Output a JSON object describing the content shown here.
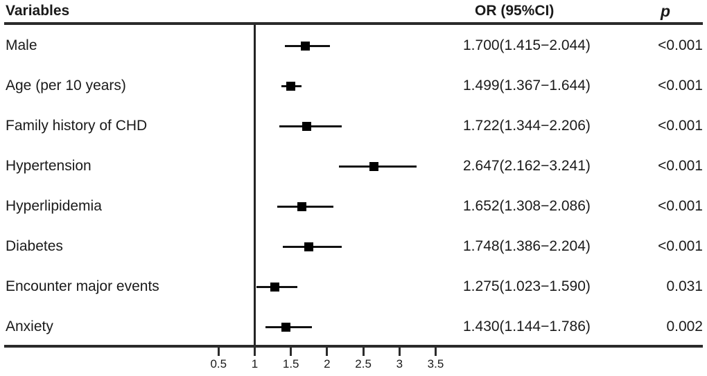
{
  "header": {
    "variables_label": "Variables",
    "or_label": "OR (95%CI)",
    "p_label": "p"
  },
  "chart_data": {
    "type": "forest",
    "title": "",
    "xlabel": "",
    "ylabel": "",
    "reference_line": 1,
    "xlim": [
      0.28,
      3.86
    ],
    "grid": false,
    "axis_ticks": [
      0.5,
      1,
      1.5,
      2,
      2.5,
      3,
      3.5
    ],
    "axis_tick_labels": [
      "0.5",
      "1",
      "1.5",
      "2",
      "2.5",
      "3",
      "3.5"
    ],
    "columns": [
      "Variables",
      "OR (95%CI)",
      "p"
    ],
    "categories": [
      "Male",
      "Age (per 10 years)",
      "Family history of CHD",
      "Hypertension",
      "Hyperlipidemia",
      "Diabetes",
      "Encounter major events",
      "Anxiety"
    ],
    "values": [
      1.7,
      1.499,
      1.722,
      2.647,
      1.652,
      1.748,
      1.275,
      1.43
    ],
    "ci_lower": [
      1.415,
      1.367,
      1.344,
      2.162,
      1.308,
      1.386,
      1.023,
      1.144
    ],
    "ci_upper": [
      2.044,
      1.644,
      2.206,
      3.241,
      2.086,
      2.204,
      1.59,
      1.786
    ],
    "rows": [
      {
        "variable": "Male",
        "or": 1.7,
        "lower": 1.415,
        "upper": 2.044,
        "or_text": "1.700(1.415−2.044)",
        "p": "<0.001"
      },
      {
        "variable": "Age (per 10 years)",
        "or": 1.499,
        "lower": 1.367,
        "upper": 1.644,
        "or_text": "1.499(1.367−1.644)",
        "p": "<0.001"
      },
      {
        "variable": "Family history of CHD",
        "or": 1.722,
        "lower": 1.344,
        "upper": 2.206,
        "or_text": "1.722(1.344−2.206)",
        "p": "<0.001"
      },
      {
        "variable": "Hypertension",
        "or": 2.647,
        "lower": 2.162,
        "upper": 3.241,
        "or_text": "2.647(2.162−3.241)",
        "p": "<0.001"
      },
      {
        "variable": "Hyperlipidemia",
        "or": 1.652,
        "lower": 1.308,
        "upper": 2.086,
        "or_text": "1.652(1.308−2.086)",
        "p": "<0.001"
      },
      {
        "variable": "Diabetes",
        "or": 1.748,
        "lower": 1.386,
        "upper": 2.204,
        "or_text": "1.748(1.386−2.204)",
        "p": "<0.001"
      },
      {
        "variable": "Encounter major events",
        "or": 1.275,
        "lower": 1.023,
        "upper": 1.59,
        "or_text": "1.275(1.023−1.590)",
        "p": "0.031"
      },
      {
        "variable": "Anxiety",
        "or": 1.43,
        "lower": 1.144,
        "upper": 1.786,
        "or_text": "1.430(1.144−1.786)",
        "p": "0.002"
      }
    ]
  },
  "style": {
    "marker_color": "#000000",
    "line_color": "#111111",
    "rule_color": "#2b2b2b",
    "text_color": "#1a1a1a",
    "background": "#ffffff"
  }
}
